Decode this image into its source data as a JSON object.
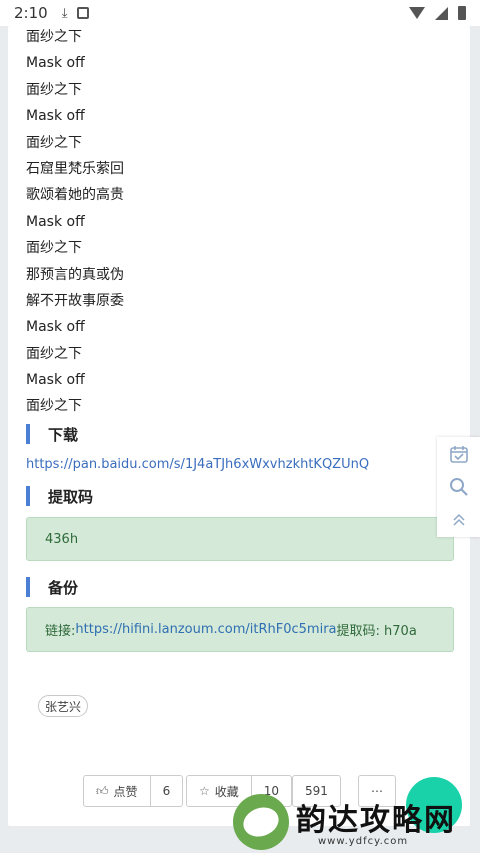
{
  "status_bar": {
    "time": "2:10"
  },
  "lyrics": [
    "面纱之下",
    "Mask off",
    "面纱之下",
    "Mask off",
    "面纱之下",
    "石窟里梵乐萦回",
    "歌颂着她的高贵",
    "Mask off",
    "面纱之下",
    "那预言的真或伪",
    "解不开故事原委",
    "Mask off",
    "面纱之下",
    "Mask off",
    "面纱之下"
  ],
  "download": {
    "heading": "下载",
    "url": "https://pan.baidu.com/s/1J4aTJh6xWxvhzkhtKQZUnQ"
  },
  "extract_code": {
    "heading": "提取码",
    "code": "436h"
  },
  "backup": {
    "heading": "备份",
    "label": "链接: ",
    "url": "https://hifini.lanzoum.com/itRhF0c5mira",
    "code_text": " 提取码: h70a"
  },
  "tag": "张艺兴",
  "actions": {
    "like_label": "点赞",
    "like_count": "6",
    "fav_label": "收藏",
    "fav_count": "10",
    "share_count": "591"
  },
  "watermark": {
    "title": "韵达攻略网",
    "sub": "www.ydfcy.com"
  },
  "colors": {
    "accent_bar": "#4a7fd4",
    "green_box_bg": "#d4e9d7",
    "fab": "#1ad2a9",
    "link": "#3a6dbd"
  }
}
